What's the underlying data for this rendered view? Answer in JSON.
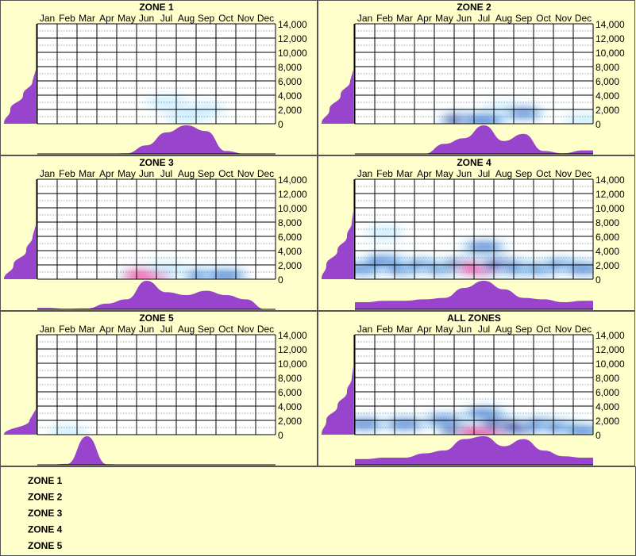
{
  "months": [
    "Jan",
    "Feb",
    "Mar",
    "Apr",
    "May",
    "Jun",
    "Jul",
    "Aug",
    "Sep",
    "Oct",
    "Nov",
    "Dec"
  ],
  "yticks": [
    "14,000",
    "12,000",
    "10,000",
    "8,000",
    "6,000",
    "4,000",
    "2,000",
    "0"
  ],
  "colors": {
    "background": "#ffffcc",
    "distribution": "#9944cc",
    "heat_low": "#cceeff",
    "heat_mid": "#0066cc",
    "heat_high": "#000099",
    "heat_peak": "#ff0099"
  },
  "chart_data": [
    {
      "type": "heatmap",
      "title": "ZONE 1",
      "x_axis": "month",
      "y_axis": "elevation",
      "ylim": [
        0,
        14000
      ],
      "month_activity": [
        0,
        0,
        0,
        0,
        0.02,
        0.3,
        0.75,
        1.0,
        0.8,
        0.1,
        0,
        0
      ],
      "elevation_profile": {
        "y": [
          0,
          2000,
          4000,
          6000
        ],
        "relative": [
          1.0,
          0.8,
          0.4,
          0.1
        ]
      },
      "hotspots": [
        {
          "month": "Jul",
          "elevation": 3000,
          "intensity": 0.25
        },
        {
          "month": "Aug",
          "elevation": 1000,
          "intensity": 0.3
        },
        {
          "month": "Sep",
          "elevation": 2000,
          "intensity": 0.2
        }
      ]
    },
    {
      "type": "heatmap",
      "title": "ZONE 2",
      "x_axis": "month",
      "y_axis": "elevation",
      "ylim": [
        0,
        14000
      ],
      "month_activity": [
        0,
        0,
        0,
        0,
        0.35,
        0.55,
        1.0,
        0.45,
        0.7,
        0.1,
        0.02,
        0.12
      ],
      "elevation_profile": {
        "y": [
          0,
          2000,
          4000,
          6000
        ],
        "relative": [
          1.0,
          0.75,
          0.4,
          0.1
        ]
      },
      "hotspots": [
        {
          "month": "Jun",
          "elevation": 500,
          "intensity": 0.75
        },
        {
          "month": "Jul",
          "elevation": 500,
          "intensity": 0.6
        },
        {
          "month": "Aug",
          "elevation": 2000,
          "intensity": 0.3
        },
        {
          "month": "Sep",
          "elevation": 1500,
          "intensity": 0.4
        },
        {
          "month": "Dec",
          "elevation": 500,
          "intensity": 0.2
        }
      ]
    },
    {
      "type": "heatmap",
      "title": "ZONE 3",
      "x_axis": "month",
      "y_axis": "elevation",
      "ylim": [
        0,
        14000
      ],
      "month_activity": [
        0.05,
        0.02,
        0.03,
        0.2,
        0.35,
        1.0,
        0.6,
        0.5,
        0.65,
        0.5,
        0.35,
        0
      ],
      "elevation_profile": {
        "y": [
          0,
          2000,
          4000,
          6000
        ],
        "relative": [
          1.0,
          0.7,
          0.3,
          0.1
        ]
      },
      "hotspots": [
        {
          "month": "Jun",
          "elevation": 500,
          "intensity": 0.9
        },
        {
          "month": "Jul",
          "elevation": 1500,
          "intensity": 0.3
        },
        {
          "month": "Sep",
          "elevation": 500,
          "intensity": 0.6
        },
        {
          "month": "Oct",
          "elevation": 500,
          "intensity": 0.5
        }
      ]
    },
    {
      "type": "heatmap",
      "title": "ZONE 4",
      "x_axis": "month",
      "y_axis": "elevation",
      "ylim": [
        0,
        14000
      ],
      "month_activity": [
        0.25,
        0.3,
        0.3,
        0.35,
        0.4,
        0.75,
        1.0,
        0.7,
        0.4,
        0.35,
        0.25,
        0.3
      ],
      "elevation_profile": {
        "y": [
          0,
          2000,
          4000,
          6000,
          8000
        ],
        "relative": [
          1.0,
          0.85,
          0.5,
          0.2,
          0.05
        ]
      },
      "hotspots": [
        {
          "month": "Jan",
          "elevation": 1500,
          "intensity": 0.55
        },
        {
          "month": "Feb",
          "elevation": 2500,
          "intensity": 0.6
        },
        {
          "month": "Mar",
          "elevation": 1500,
          "intensity": 0.55
        },
        {
          "month": "Apr",
          "elevation": 2000,
          "intensity": 0.5
        },
        {
          "month": "May",
          "elevation": 1500,
          "intensity": 0.5
        },
        {
          "month": "Jun",
          "elevation": 2000,
          "intensity": 0.65
        },
        {
          "month": "Jul",
          "elevation": 1500,
          "intensity": 1.0
        },
        {
          "month": "Jul",
          "elevation": 4500,
          "intensity": 0.5
        },
        {
          "month": "Aug",
          "elevation": 2000,
          "intensity": 0.7
        },
        {
          "month": "Sep",
          "elevation": 1500,
          "intensity": 0.6
        },
        {
          "month": "Oct",
          "elevation": 1500,
          "intensity": 0.5
        },
        {
          "month": "Nov",
          "elevation": 2000,
          "intensity": 0.45
        },
        {
          "month": "Dec",
          "elevation": 1500,
          "intensity": 0.45
        },
        {
          "month": "Feb",
          "elevation": 6500,
          "intensity": 0.2
        }
      ]
    },
    {
      "type": "heatmap",
      "title": "ZONE 5",
      "x_axis": "month",
      "y_axis": "elevation",
      "ylim": [
        0,
        14000
      ],
      "month_activity": [
        0,
        0.03,
        1.0,
        0.02,
        0,
        0,
        0,
        0,
        0,
        0,
        0,
        0
      ],
      "elevation_profile": {
        "y": [
          0,
          2000
        ],
        "relative": [
          1.0,
          0.2
        ]
      },
      "hotspots": [
        {
          "month": "Feb",
          "elevation": 300,
          "intensity": 0.2
        }
      ]
    },
    {
      "type": "heatmap",
      "title": "ALL ZONES",
      "x_axis": "month",
      "y_axis": "elevation",
      "ylim": [
        0,
        14000
      ],
      "month_activity": [
        0.2,
        0.25,
        0.25,
        0.4,
        0.5,
        0.9,
        1.0,
        0.65,
        0.9,
        0.5,
        0.3,
        0.25
      ],
      "elevation_profile": {
        "y": [
          0,
          2000,
          4000,
          6000,
          8000
        ],
        "relative": [
          1.0,
          0.85,
          0.5,
          0.2,
          0.05
        ]
      },
      "hotspots": [
        {
          "month": "Jan",
          "elevation": 1500,
          "intensity": 0.5
        },
        {
          "month": "Mar",
          "elevation": 1500,
          "intensity": 0.5
        },
        {
          "month": "May",
          "elevation": 2000,
          "intensity": 0.5
        },
        {
          "month": "Jun",
          "elevation": 500,
          "intensity": 0.8
        },
        {
          "month": "Jul",
          "elevation": 200,
          "intensity": 1.0
        },
        {
          "month": "Jul",
          "elevation": 3000,
          "intensity": 0.45
        },
        {
          "month": "Aug",
          "elevation": 1500,
          "intensity": 0.7
        },
        {
          "month": "Sep",
          "elevation": 1000,
          "intensity": 0.75
        },
        {
          "month": "Oct",
          "elevation": 1500,
          "intensity": 0.5
        },
        {
          "month": "Nov",
          "elevation": 1000,
          "intensity": 0.5
        },
        {
          "month": "Dec",
          "elevation": 500,
          "intensity": 0.45
        }
      ]
    }
  ],
  "legend": {
    "zones": [
      "ZONE 1",
      "ZONE 2",
      "ZONE 3",
      "ZONE 4",
      "ZONE 5"
    ]
  }
}
